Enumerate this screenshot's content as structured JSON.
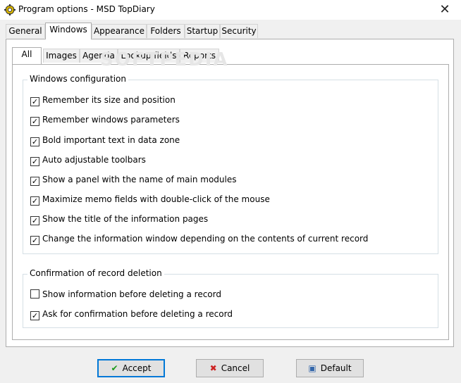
{
  "window": {
    "title": "Program options - MSD TopDiary",
    "close_glyph": "✕",
    "app_icon": "gear-icon"
  },
  "outer_tabs": [
    {
      "label": "General",
      "active": false
    },
    {
      "label": "Windows",
      "active": true
    },
    {
      "label": "Appearance",
      "active": false
    },
    {
      "label": "Folders",
      "active": false
    },
    {
      "label": "Startup",
      "active": false
    },
    {
      "label": "Security",
      "active": false
    }
  ],
  "inner_tabs": [
    {
      "label": "All",
      "active": true
    },
    {
      "label": "Images",
      "active": false
    },
    {
      "label": "Agenda",
      "active": false
    },
    {
      "label": "Lookup fields",
      "active": false
    },
    {
      "label": "Reports",
      "active": false
    }
  ],
  "watermark": "SOFTPEDIA",
  "windows_config": {
    "label": "Windows configuration",
    "items": [
      {
        "label": "Remember its size and position",
        "checked": true
      },
      {
        "label": "Remember windows parameters",
        "checked": true
      },
      {
        "label": "Bold important text in data zone",
        "checked": true
      },
      {
        "label": "Auto adjustable toolbars",
        "checked": true
      },
      {
        "label": "Show a panel with the name of main modules",
        "checked": true
      },
      {
        "label": "Maximize memo fields with double-click of the mouse",
        "checked": true
      },
      {
        "label": "Show the title of the information pages",
        "checked": true
      },
      {
        "label": "Change the information window depending on the contents of current record",
        "checked": true
      }
    ]
  },
  "deletion_config": {
    "label": "Confirmation of record deletion",
    "items": [
      {
        "label": "Show information before deleting a record",
        "checked": false
      },
      {
        "label": "Ask for confirmation before deleting a record",
        "checked": true
      }
    ]
  },
  "buttons": {
    "accept": {
      "label": "Accept",
      "icon": "check-icon",
      "color": "#1a9a1a"
    },
    "cancel": {
      "label": "Cancel",
      "icon": "x-icon",
      "color": "#cc2222"
    },
    "default": {
      "label": "Default",
      "icon": "default-icon",
      "color": "#3366aa"
    }
  }
}
